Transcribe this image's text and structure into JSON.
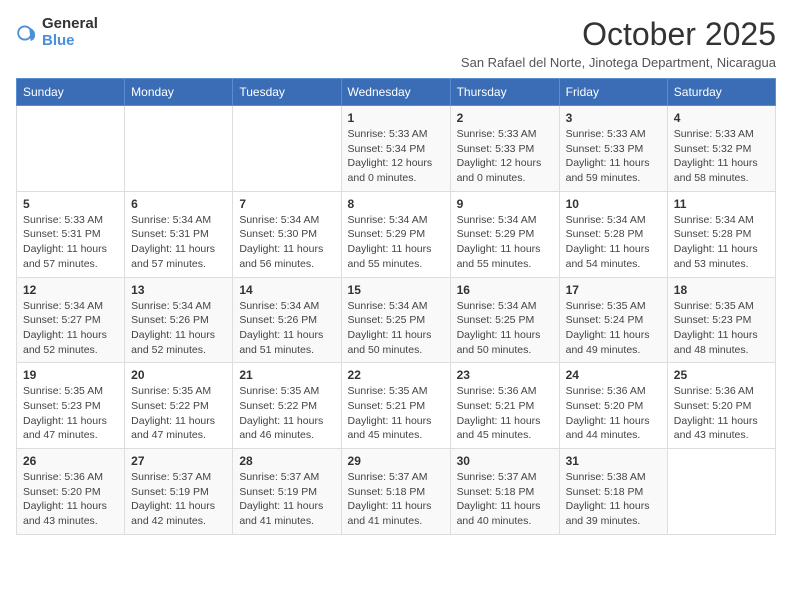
{
  "logo": {
    "text_general": "General",
    "text_blue": "Blue"
  },
  "header": {
    "title": "October 2025",
    "subtitle": "San Rafael del Norte, Jinotega Department, Nicaragua"
  },
  "days_of_week": [
    "Sunday",
    "Monday",
    "Tuesday",
    "Wednesday",
    "Thursday",
    "Friday",
    "Saturday"
  ],
  "weeks": [
    {
      "days": [
        {
          "num": "",
          "info": ""
        },
        {
          "num": "",
          "info": ""
        },
        {
          "num": "",
          "info": ""
        },
        {
          "num": "1",
          "info": "Sunrise: 5:33 AM\nSunset: 5:34 PM\nDaylight: 12 hours\nand 0 minutes."
        },
        {
          "num": "2",
          "info": "Sunrise: 5:33 AM\nSunset: 5:33 PM\nDaylight: 12 hours\nand 0 minutes."
        },
        {
          "num": "3",
          "info": "Sunrise: 5:33 AM\nSunset: 5:33 PM\nDaylight: 11 hours\nand 59 minutes."
        },
        {
          "num": "4",
          "info": "Sunrise: 5:33 AM\nSunset: 5:32 PM\nDaylight: 11 hours\nand 58 minutes."
        }
      ]
    },
    {
      "days": [
        {
          "num": "5",
          "info": "Sunrise: 5:33 AM\nSunset: 5:31 PM\nDaylight: 11 hours\nand 57 minutes."
        },
        {
          "num": "6",
          "info": "Sunrise: 5:34 AM\nSunset: 5:31 PM\nDaylight: 11 hours\nand 57 minutes."
        },
        {
          "num": "7",
          "info": "Sunrise: 5:34 AM\nSunset: 5:30 PM\nDaylight: 11 hours\nand 56 minutes."
        },
        {
          "num": "8",
          "info": "Sunrise: 5:34 AM\nSunset: 5:29 PM\nDaylight: 11 hours\nand 55 minutes."
        },
        {
          "num": "9",
          "info": "Sunrise: 5:34 AM\nSunset: 5:29 PM\nDaylight: 11 hours\nand 55 minutes."
        },
        {
          "num": "10",
          "info": "Sunrise: 5:34 AM\nSunset: 5:28 PM\nDaylight: 11 hours\nand 54 minutes."
        },
        {
          "num": "11",
          "info": "Sunrise: 5:34 AM\nSunset: 5:28 PM\nDaylight: 11 hours\nand 53 minutes."
        }
      ]
    },
    {
      "days": [
        {
          "num": "12",
          "info": "Sunrise: 5:34 AM\nSunset: 5:27 PM\nDaylight: 11 hours\nand 52 minutes."
        },
        {
          "num": "13",
          "info": "Sunrise: 5:34 AM\nSunset: 5:26 PM\nDaylight: 11 hours\nand 52 minutes."
        },
        {
          "num": "14",
          "info": "Sunrise: 5:34 AM\nSunset: 5:26 PM\nDaylight: 11 hours\nand 51 minutes."
        },
        {
          "num": "15",
          "info": "Sunrise: 5:34 AM\nSunset: 5:25 PM\nDaylight: 11 hours\nand 50 minutes."
        },
        {
          "num": "16",
          "info": "Sunrise: 5:34 AM\nSunset: 5:25 PM\nDaylight: 11 hours\nand 50 minutes."
        },
        {
          "num": "17",
          "info": "Sunrise: 5:35 AM\nSunset: 5:24 PM\nDaylight: 11 hours\nand 49 minutes."
        },
        {
          "num": "18",
          "info": "Sunrise: 5:35 AM\nSunset: 5:23 PM\nDaylight: 11 hours\nand 48 minutes."
        }
      ]
    },
    {
      "days": [
        {
          "num": "19",
          "info": "Sunrise: 5:35 AM\nSunset: 5:23 PM\nDaylight: 11 hours\nand 47 minutes."
        },
        {
          "num": "20",
          "info": "Sunrise: 5:35 AM\nSunset: 5:22 PM\nDaylight: 11 hours\nand 47 minutes."
        },
        {
          "num": "21",
          "info": "Sunrise: 5:35 AM\nSunset: 5:22 PM\nDaylight: 11 hours\nand 46 minutes."
        },
        {
          "num": "22",
          "info": "Sunrise: 5:35 AM\nSunset: 5:21 PM\nDaylight: 11 hours\nand 45 minutes."
        },
        {
          "num": "23",
          "info": "Sunrise: 5:36 AM\nSunset: 5:21 PM\nDaylight: 11 hours\nand 45 minutes."
        },
        {
          "num": "24",
          "info": "Sunrise: 5:36 AM\nSunset: 5:20 PM\nDaylight: 11 hours\nand 44 minutes."
        },
        {
          "num": "25",
          "info": "Sunrise: 5:36 AM\nSunset: 5:20 PM\nDaylight: 11 hours\nand 43 minutes."
        }
      ]
    },
    {
      "days": [
        {
          "num": "26",
          "info": "Sunrise: 5:36 AM\nSunset: 5:20 PM\nDaylight: 11 hours\nand 43 minutes."
        },
        {
          "num": "27",
          "info": "Sunrise: 5:37 AM\nSunset: 5:19 PM\nDaylight: 11 hours\nand 42 minutes."
        },
        {
          "num": "28",
          "info": "Sunrise: 5:37 AM\nSunset: 5:19 PM\nDaylight: 11 hours\nand 41 minutes."
        },
        {
          "num": "29",
          "info": "Sunrise: 5:37 AM\nSunset: 5:18 PM\nDaylight: 11 hours\nand 41 minutes."
        },
        {
          "num": "30",
          "info": "Sunrise: 5:37 AM\nSunset: 5:18 PM\nDaylight: 11 hours\nand 40 minutes."
        },
        {
          "num": "31",
          "info": "Sunrise: 5:38 AM\nSunset: 5:18 PM\nDaylight: 11 hours\nand 39 minutes."
        },
        {
          "num": "",
          "info": ""
        }
      ]
    }
  ]
}
